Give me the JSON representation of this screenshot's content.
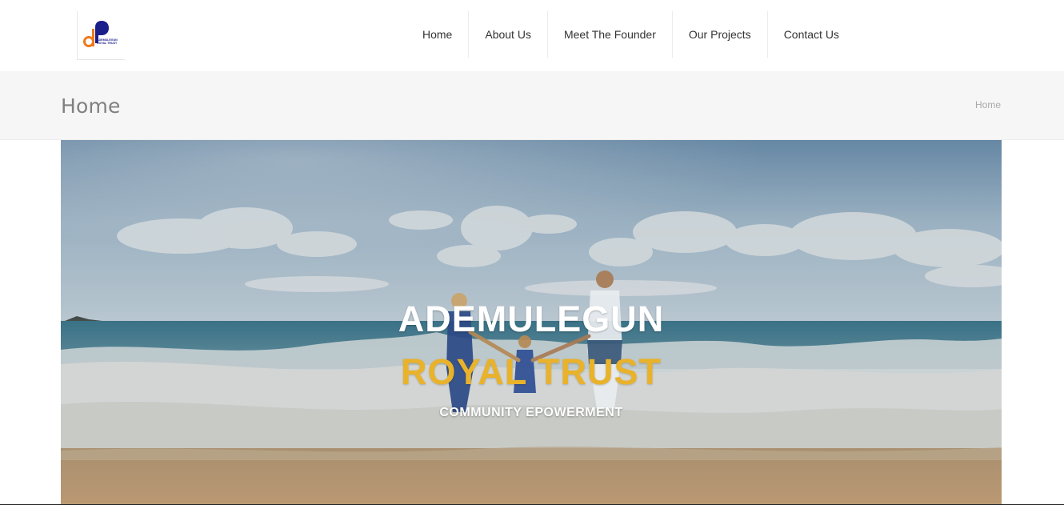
{
  "header": {
    "logo_icon": "ademulegun-royal-trust-logo",
    "logo_text": [
      "ADEMULEGUN",
      "ROYAL TRUST"
    ],
    "nav": [
      {
        "label": "Home"
      },
      {
        "label": "About Us"
      },
      {
        "label": "Meet The Founder"
      },
      {
        "label": "Our Projects"
      },
      {
        "label": "Contact Us"
      }
    ]
  },
  "title_bar": {
    "title": "Home",
    "breadcrumb": "Home"
  },
  "hero": {
    "image": "beach-family-photo",
    "line1": "ADEMULEGUN",
    "line2": "ROYAL TRUST",
    "line3": "COMMUNITY EPOWERMENT",
    "colors": {
      "line1": "#ffffff",
      "line2": "#e9b22b",
      "line3": "#ffffff"
    }
  }
}
